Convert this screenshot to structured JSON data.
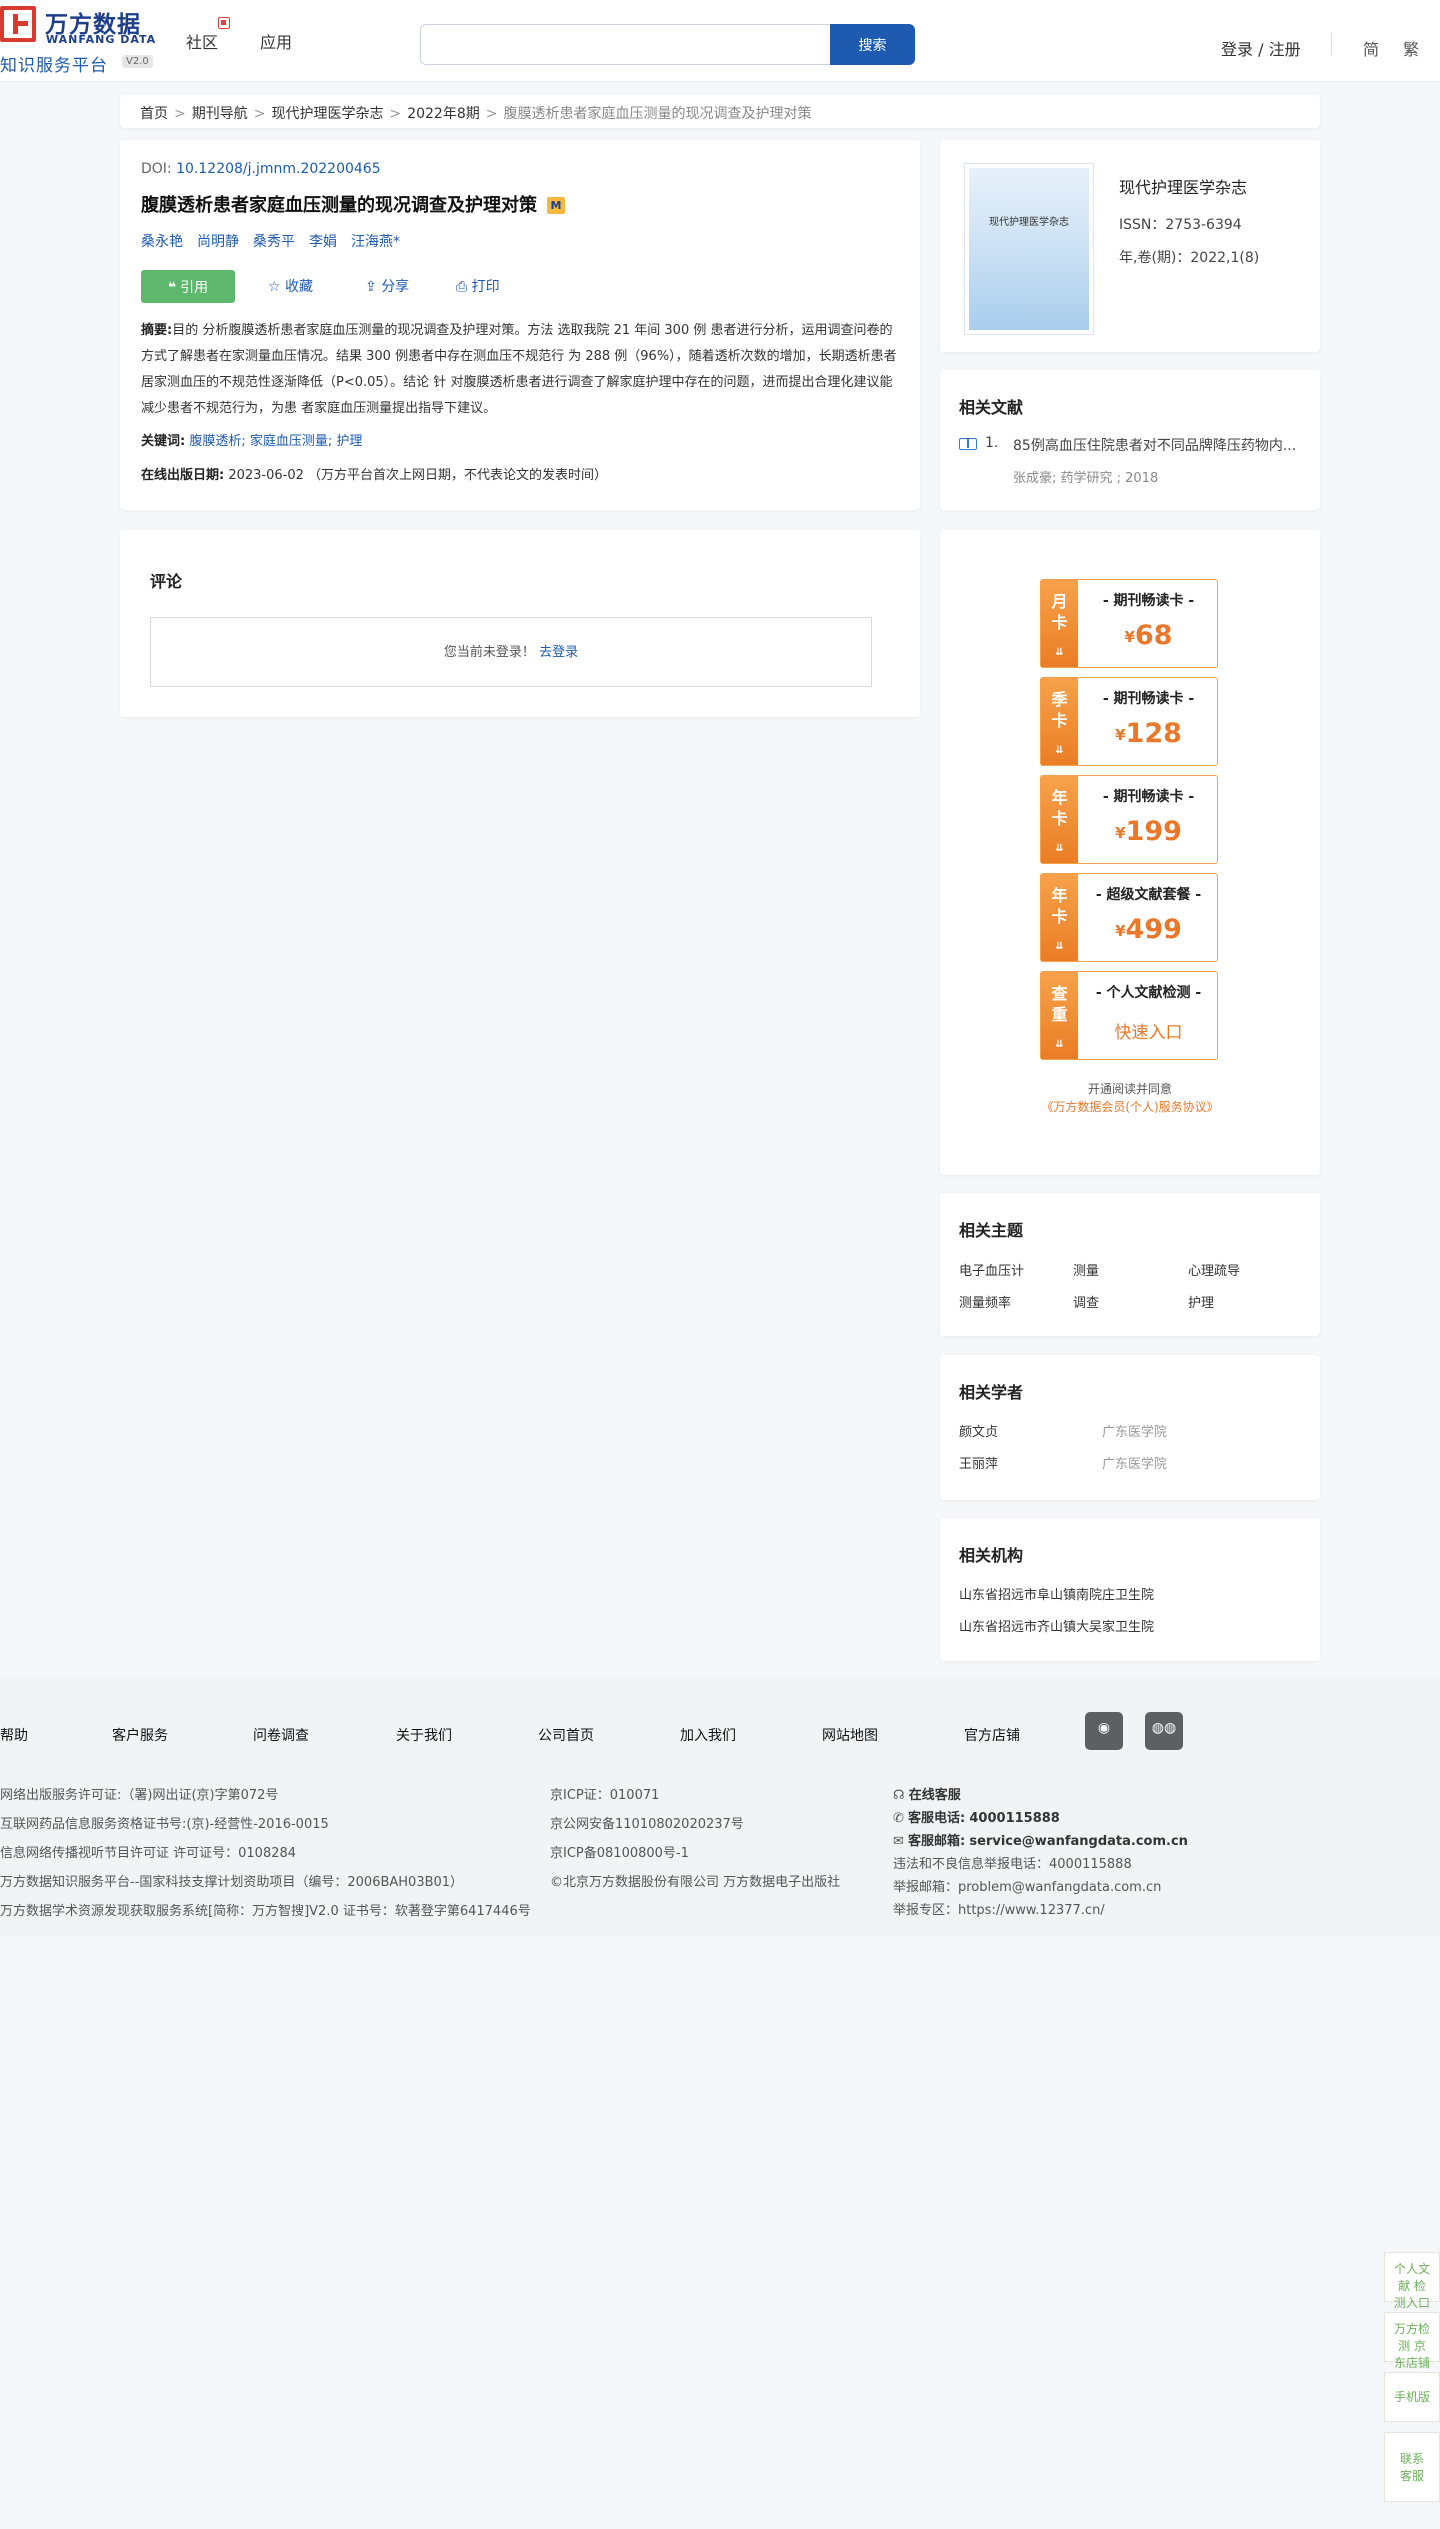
{
  "header": {
    "logo_cn": "万方数据",
    "logo_en": "WANFANG DATA",
    "logo_sub": "知识服务平台",
    "logo_version": "V2.0",
    "nav": [
      "社区",
      "应用"
    ],
    "search_placeholder": "",
    "search_button": "搜索",
    "login": "登录 / 注册",
    "lang_simplified": "简",
    "lang_traditional": "繁"
  },
  "breadcrumb": {
    "items": [
      "首页",
      "期刊导航",
      "现代护理医学杂志",
      "2022年8期"
    ],
    "current": "腹膜透析患者家庭血压测量的现况调查及护理对策",
    "separator": ">"
  },
  "article": {
    "doi_label": "DOI:",
    "doi": "10.12208/j.jmnm.202200465",
    "title": "腹膜透析患者家庭血压测量的现况调查及护理对策",
    "title_badge": "M",
    "authors": [
      "桑永艳",
      "尚明静",
      "桑秀平",
      "李娟",
      "汪海燕*"
    ],
    "actions": {
      "cite": "引用",
      "favorite": "收藏",
      "share": "分享",
      "print": "打印"
    },
    "abstract_label": "摘要:",
    "abstract": "目的 分析腹膜透析患者家庭血压测量的现况调查及护理对策。方法 选取我院 21 年间 300 例 患者进行分析，运用调查问卷的方式了解患者在家测量血压情况。结果 300 例患者中存在测血压不规范行 为 288 例（96%），随着透析次数的增加，长期透析患者居家测血压的不规范性逐渐降低（P<0.05）。结论 针 对腹膜透析患者进行调查了解家庭护理中存在的问题，进而提出合理化建议能减少患者不规范行为，为患 者家庭血压测量提出指导下建议。",
    "keywords_label": "关键词:",
    "keywords": [
      "腹膜透析;",
      "家庭血压测量;",
      "护理"
    ],
    "pub_label": "在线出版日期:",
    "pub_date": "2023-06-02",
    "pub_note": "（万方平台首次上网日期，不代表论文的发表时间）"
  },
  "comment": {
    "title": "评论",
    "not_logged_in": "您当前未登录！",
    "login_link": "去登录"
  },
  "journal": {
    "cover_title": "现代护理医学杂志",
    "name": "现代护理医学杂志",
    "issn": "ISSN：2753-6394",
    "volume": "年,卷(期)：2022,1(8)"
  },
  "related_docs": {
    "title": "相关文献",
    "items": [
      {
        "num": "1.",
        "title": "85例高血压住院患者对不同品牌降压药物内...",
        "meta": "张成豪; 药学研究 ; 2018"
      }
    ]
  },
  "promo": {
    "cards": [
      {
        "side": [
          "月",
          "卡"
        ],
        "name": "- 期刊畅读卡 -",
        "currency": "¥",
        "price": "68"
      },
      {
        "side": [
          "季",
          "卡"
        ],
        "name": "- 期刊畅读卡 -",
        "currency": "¥",
        "price": "128"
      },
      {
        "side": [
          "年",
          "卡"
        ],
        "name": "- 期刊畅读卡 -",
        "currency": "¥",
        "price": "199"
      },
      {
        "side": [
          "年",
          "卡"
        ],
        "name": "- 超级文献套餐 -",
        "currency": "¥",
        "price": "499"
      },
      {
        "side": [
          "查",
          "重"
        ],
        "name": "- 个人文献检测 -",
        "quick": "快速入口"
      }
    ],
    "chevron": "⇊",
    "agree_text": "开通阅读并同意",
    "agree_link": "《万方数据会员(个人)服务协议》"
  },
  "topics": {
    "title": "相关主题",
    "items": [
      "电子血压计",
      "测量",
      "心理疏导",
      "测量频率",
      "调查",
      "护理"
    ]
  },
  "scholars": {
    "title": "相关学者",
    "items": [
      {
        "name": "颜文贞",
        "org": "广东医学院"
      },
      {
        "name": "王丽萍",
        "org": "广东医学院"
      }
    ]
  },
  "orgs": {
    "title": "相关机构",
    "items": [
      "山东省招远市阜山镇南院庄卫生院",
      "山东省招远市齐山镇大吴家卫生院"
    ]
  },
  "footer": {
    "nav": [
      "帮助",
      "客户服务",
      "问卷调查",
      "关于我们",
      "公司首页",
      "加入我们",
      "网站地图",
      "官方店铺"
    ],
    "social": [
      "weibo-icon",
      "wechat-icon"
    ],
    "left": [
      "网络出版服务许可证:（署)网出证(京)字第072号",
      "互联网药品信息服务资格证书号:(京)-经营性-2016-0015",
      "信息网络传播视听节目许可证 许可证号：0108284",
      "万方数据知识服务平台--国家科技支撑计划资助项目（编号：2006BAH03B01）",
      "万方数据学术资源发现获取服务系统[简称：万方智搜]V2.0 证书号：软著登字第6417446号"
    ],
    "middle": [
      "京ICP证：010071",
      "京公网安备11010802020237号",
      "京ICP备08100800号-1",
      "©北京万方数据股份有限公司 万方数据电子出版社"
    ],
    "online_service": "在线客服",
    "phone_label": "客服电话:",
    "phone": "4000115888",
    "email_label": "客服邮箱:",
    "email": "service@wanfangdata.com.cn",
    "report_phone": "违法和不良信息举报电话：4000115888",
    "report_email": "举报邮箱：problem@wanfangdata.com.cn",
    "report_zone": "举报专区：https://www.12377.cn/"
  },
  "side_float": [
    "个人文献 检测入口",
    "万方检测 京东店铺",
    "手机版",
    "联系 客服"
  ]
}
